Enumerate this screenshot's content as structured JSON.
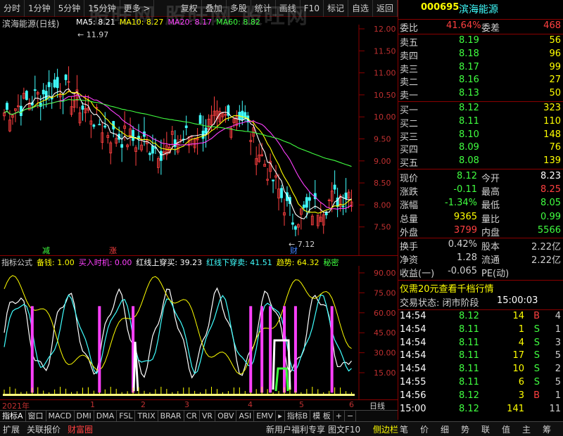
{
  "toolbar": {
    "left_items": [
      "分时",
      "1分钟",
      "5分钟",
      "15分钟",
      "更多 >"
    ],
    "right_items": [
      "复权",
      "叠加",
      "多股",
      "统计",
      "画线",
      "F10",
      "标记",
      "自选",
      "返回"
    ]
  },
  "watermark": "股旺网 股旺网 股旺网",
  "main_chart": {
    "title": "滨海能源(日线)",
    "ma_labels": [
      {
        "text": "MA5: 8.21",
        "color": "#ffffff"
      },
      {
        "text": "MA10: 8.27",
        "color": "#ffff00"
      },
      {
        "text": "MA20: 8.17",
        "color": "#ff40ff"
      },
      {
        "text": "MA60: 8.82",
        "color": "#40ff40"
      }
    ],
    "high_label": "11.97",
    "low_label": "7.12",
    "y_ticks": [
      "12.00",
      "11.50",
      "11.00",
      "10.50",
      "10.00",
      "9.50",
      "9.00",
      "8.50",
      "8.00",
      "7.50"
    ],
    "markers": [
      {
        "text": "减",
        "color": "#40ff40"
      },
      {
        "text": "涨",
        "color": "#ff4040"
      },
      {
        "text": "财",
        "color": "#4080ff"
      }
    ]
  },
  "indicator": {
    "legend": [
      {
        "text": "指标公式",
        "color": "#d0d0d0"
      },
      {
        "text": "备钱: 1.00",
        "color": "#ffff00"
      },
      {
        "text": "买入时机: 0.00",
        "color": "#ff40ff"
      },
      {
        "text": "红线上穿买: 39.23",
        "color": "#ffffff"
      },
      {
        "text": "红线下穿卖: 41.51",
        "color": "#40ffff"
      },
      {
        "text": "趋势: 64.32",
        "color": "#ffff00"
      },
      {
        "text": "秘密",
        "color": "#40ff40"
      }
    ],
    "y_ticks": [
      "90.00",
      "75.00",
      "60.00",
      "45.00",
      "30.00",
      "15.00"
    ]
  },
  "x_axis": {
    "year_label": "2021年",
    "months": [
      "1",
      "2",
      "3",
      "4",
      "5",
      "6"
    ],
    "period": "日线"
  },
  "bottom_tabs": [
    "指标A",
    "窗口",
    "MACD",
    "DMI",
    "DMA",
    "FSL",
    "TRIX",
    "BRAR",
    "CR",
    "VR",
    "OBV",
    "ASI",
    "EMV",
    "▸",
    "指标B",
    "模 板",
    "+",
    "−"
  ],
  "quote": {
    "code": "000695",
    "name": "滨海能源",
    "ratio_label": "委比",
    "ratio_value": "41.64%",
    "diff_label": "委差",
    "diff_value": "468",
    "asks": [
      {
        "label": "卖五",
        "price": "8.19",
        "vol": "56"
      },
      {
        "label": "卖四",
        "price": "8.18",
        "vol": "96"
      },
      {
        "label": "卖三",
        "price": "8.17",
        "vol": "99"
      },
      {
        "label": "卖二",
        "price": "8.16",
        "vol": "27"
      },
      {
        "label": "卖一",
        "price": "8.13",
        "vol": "50"
      }
    ],
    "bids": [
      {
        "label": "买一",
        "price": "8.12",
        "vol": "323"
      },
      {
        "label": "买二",
        "price": "8.11",
        "vol": "110"
      },
      {
        "label": "买三",
        "price": "8.10",
        "vol": "148"
      },
      {
        "label": "买四",
        "price": "8.09",
        "vol": "76"
      },
      {
        "label": "买五",
        "price": "8.08",
        "vol": "139"
      }
    ],
    "stats": [
      {
        "l1": "现价",
        "v1": "8.12",
        "c1": "#40ff40",
        "l2": "今开",
        "v2": "8.23",
        "c2": "#ffffff"
      },
      {
        "l1": "涨跌",
        "v1": "-0.11",
        "c1": "#40ff40",
        "l2": "最高",
        "v2": "8.25",
        "c2": "#ff4040"
      },
      {
        "l1": "涨幅",
        "v1": "-1.34%",
        "c1": "#40ff40",
        "l2": "最低",
        "v2": "8.05",
        "c2": "#40ff40"
      },
      {
        "l1": "总量",
        "v1": "9365",
        "c1": "#ffff00",
        "l2": "量比",
        "v2": "0.99",
        "c2": "#40ff40"
      },
      {
        "l1": "外盘",
        "v1": "3799",
        "c1": "#ff4040",
        "l2": "内盘",
        "v2": "5566",
        "c2": "#40ff40"
      }
    ],
    "fund": [
      {
        "l1": "换手",
        "v1": "0.42%",
        "l2": "股本",
        "v2": "2.22亿"
      },
      {
        "l1": "净资",
        "v1": "1.28",
        "l2": "流通",
        "v2": "2.22亿"
      },
      {
        "l1": "收益(一)",
        "v1": "-0.065",
        "l2": "PE(动)",
        "v2": ""
      }
    ],
    "promo": "仅需20元查看千档行情",
    "status_label": "交易状态: 闭市阶段",
    "status_time": "15:00:03",
    "ticks": [
      {
        "t": "14:54",
        "p": "8.12",
        "v": "14",
        "d": "B",
        "n": "4"
      },
      {
        "t": "14:54",
        "p": "8.11",
        "v": "1",
        "d": "S",
        "n": "1"
      },
      {
        "t": "14:54",
        "p": "8.11",
        "v": "4",
        "d": "S",
        "n": "3"
      },
      {
        "t": "14:54",
        "p": "8.11",
        "v": "17",
        "d": "S",
        "n": "5"
      },
      {
        "t": "14:54",
        "p": "8.11",
        "v": "10",
        "d": "S",
        "n": "2"
      },
      {
        "t": "14:55",
        "p": "8.11",
        "v": "6",
        "d": "S",
        "n": "5"
      },
      {
        "t": "14:56",
        "p": "8.12",
        "v": "3",
        "d": "B",
        "n": "1"
      },
      {
        "t": "15:00",
        "p": "8.12",
        "v": "141",
        "d": "",
        "n": "11"
      }
    ]
  },
  "statusbar": {
    "left": [
      "扩展",
      "关联报价",
      "财富圈"
    ],
    "mid": [
      "新用户福利专享",
      "图文F10",
      "侧边栏"
    ],
    "right": [
      "笔",
      "价",
      "细",
      "势",
      "联",
      "值",
      "主",
      "筹"
    ]
  }
}
